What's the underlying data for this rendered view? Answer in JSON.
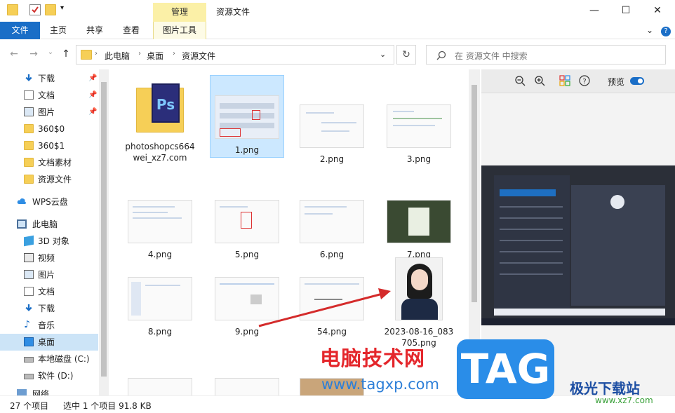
{
  "window": {
    "title": "资源文件",
    "manage_tab": "管理",
    "minimize": "—",
    "maximize": "☐",
    "close": "✕"
  },
  "ribbon": {
    "tabs": [
      "文件",
      "主页",
      "共享",
      "查看",
      "图片工具"
    ],
    "collapse": "⌄",
    "help": "?"
  },
  "address": {
    "back": "←",
    "forward": "→",
    "recent": "⌄",
    "up": "↑",
    "crumbs": [
      "此电脑",
      "桌面",
      "资源文件"
    ],
    "dropdown": "⌄",
    "refresh": "↻",
    "search_placeholder": "在 资源文件 中搜索"
  },
  "sidebar": {
    "items": [
      {
        "label": "下载",
        "icon": "download-icon",
        "pinned": true
      },
      {
        "label": "文档",
        "icon": "document-icon",
        "pinned": true
      },
      {
        "label": "图片",
        "icon": "picture-icon",
        "pinned": true
      },
      {
        "label": "360$0",
        "icon": "folder-icon",
        "pinned": false
      },
      {
        "label": "360$1",
        "icon": "folder-icon",
        "pinned": false
      },
      {
        "label": "文档素材",
        "icon": "folder-icon",
        "pinned": false
      },
      {
        "label": "资源文件",
        "icon": "folder-icon",
        "pinned": false
      },
      {
        "label": "WPS云盘",
        "icon": "cloud-icon",
        "pinned": false
      },
      {
        "label": "此电脑",
        "icon": "computer-icon",
        "pinned": false
      },
      {
        "label": "3D 对象",
        "icon": "cube-icon",
        "pinned": false
      },
      {
        "label": "视频",
        "icon": "video-icon",
        "pinned": false
      },
      {
        "label": "图片",
        "icon": "picture-icon",
        "pinned": false
      },
      {
        "label": "文档",
        "icon": "document-icon",
        "pinned": false
      },
      {
        "label": "下载",
        "icon": "download-icon",
        "pinned": false
      },
      {
        "label": "音乐",
        "icon": "music-icon",
        "pinned": false
      },
      {
        "label": "桌面",
        "icon": "desktop-icon",
        "pinned": false,
        "selected": true
      },
      {
        "label": "本地磁盘 (C:)",
        "icon": "drive-icon",
        "pinned": false
      },
      {
        "label": "软件 (D:)",
        "icon": "drive-icon",
        "pinned": false
      },
      {
        "label": "网络",
        "icon": "network-icon",
        "pinned": false
      }
    ]
  },
  "files": [
    {
      "name": "photoshopcs664wei_xz7.com",
      "kind": "folder"
    },
    {
      "name": "1.png",
      "kind": "image",
      "selected": true
    },
    {
      "name": "2.png",
      "kind": "image"
    },
    {
      "name": "3.png",
      "kind": "image"
    },
    {
      "name": "4.png",
      "kind": "image"
    },
    {
      "name": "5.png",
      "kind": "image"
    },
    {
      "name": "6.png",
      "kind": "image"
    },
    {
      "name": "7.png",
      "kind": "image"
    },
    {
      "name": "8.png",
      "kind": "image"
    },
    {
      "name": "9.png",
      "kind": "image"
    },
    {
      "name": "54.png",
      "kind": "image"
    },
    {
      "name": "2023-08-16_083705.png",
      "kind": "image"
    }
  ],
  "preview": {
    "zoom_out": "−",
    "zoom_in": "+",
    "label": "预览"
  },
  "status": {
    "count": "27 个项目",
    "selection": "选中 1 个项目  91.8 KB"
  },
  "watermarks": {
    "site_name": "电脑技术网",
    "site_url": "www.tagxp.com",
    "tag": "TAG",
    "brand": "极光下载站",
    "brand_url": "www.xz7.com"
  }
}
